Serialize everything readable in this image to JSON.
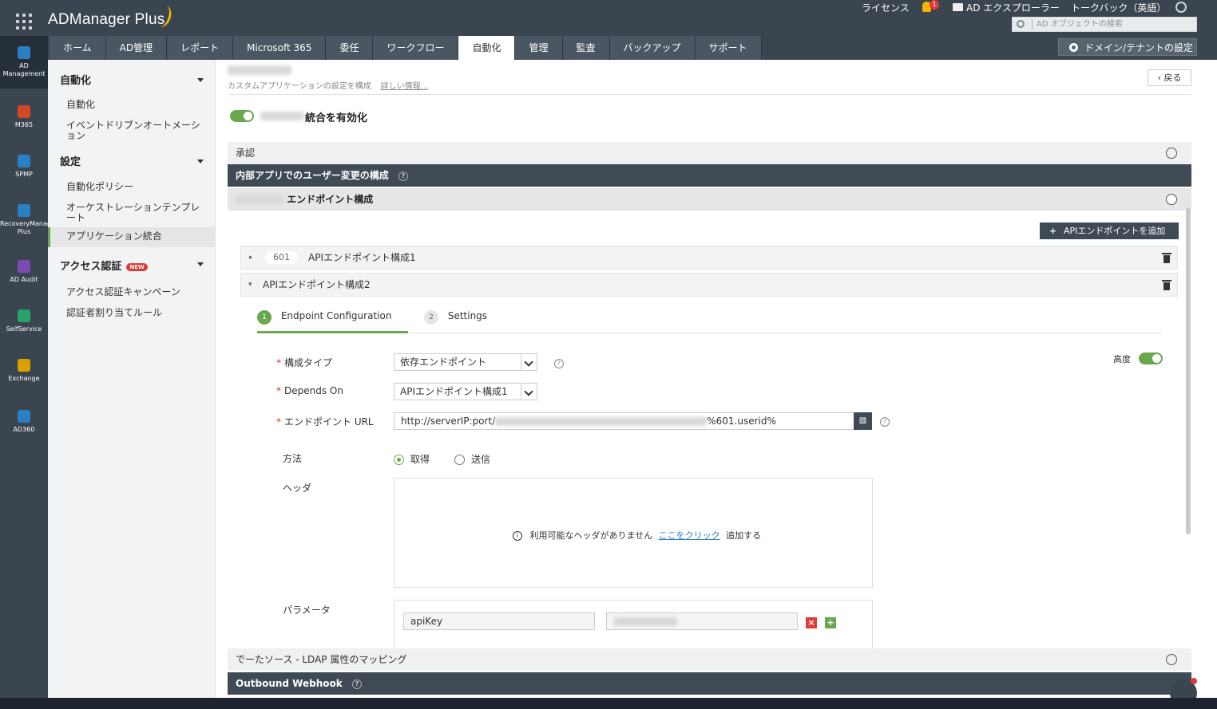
{
  "app": {
    "brand": "ADManager Plus",
    "top_links": {
      "license": "ライセンス",
      "notification_count": "1",
      "ad_explorer": "AD エクスプローラー",
      "talkback": "トークバック（英語）"
    },
    "search_placeholder": "AD オブジェクトの検索",
    "domain_button": "ドメイン/テナントの設定"
  },
  "tabs": [
    "ホーム",
    "AD管理",
    "レポート",
    "Microsoft 365",
    "委任",
    "ワークフロー",
    "自動化",
    "管理",
    "監査",
    "バックアップ",
    "サポート"
  ],
  "active_tab": "自動化",
  "rail": [
    {
      "label": "AD Management",
      "icon": "ad-management-icon",
      "color": "#2b7fc4"
    },
    {
      "label": "M365",
      "icon": "m365-icon",
      "color": "#d24726"
    },
    {
      "label": "SPMP",
      "icon": "spmp-icon",
      "color": "#2b7fc4"
    },
    {
      "label": "RecoveryManager Plus",
      "icon": "recovery-icon",
      "color": "#2b7fc4"
    },
    {
      "label": "AD Audit",
      "icon": "ad-audit-icon",
      "color": "#7a4bb5"
    },
    {
      "label": "SelfService",
      "icon": "selfservice-icon",
      "color": "#27a36a"
    },
    {
      "label": "Exchange",
      "icon": "exchange-icon",
      "color": "#d9a000"
    },
    {
      "label": "AD360",
      "icon": "ad360-icon",
      "color": "#2b7fc4"
    }
  ],
  "sidebar": {
    "automation_head": "自動化",
    "automation_items": [
      "自動化",
      "イベントドリブンオートメーション"
    ],
    "settings_head": "設定",
    "settings_items": [
      "自動化ポリシー",
      "オーケストレーションテンプレート",
      "アプリケーション統合"
    ],
    "access_head": "アクセス認証",
    "new_badge": "NEW",
    "access_items": [
      "アクセス認証キャンペーン",
      "認証者割り当てルール"
    ]
  },
  "main": {
    "subtitle": "カスタムアプリケーションの設定を構成",
    "more_info": "詳しい情報...",
    "back": "戻る",
    "enable_label": "統合を有効化",
    "sections": {
      "approval": "承認",
      "user_change": "内部アプリでのユーザー変更の構成",
      "endpoint_config": "エンドポイント構成",
      "datasource": "でーたソース - LDAP 属性のマッピング",
      "webhook": "Outbound Webhook"
    },
    "add_api_button": "APIエンドポイントを追加",
    "endpoint1": {
      "code": "601",
      "name": "APIエンドポイント構成1"
    },
    "endpoint2": {
      "name": "APIエンドポイント構成2"
    },
    "steps": [
      {
        "num": "1",
        "label": "Endpoint Configuration"
      },
      {
        "num": "2",
        "label": "Settings"
      }
    ],
    "advanced_label": "高度",
    "form": {
      "config_type_label": "構成タイプ",
      "config_type_value": "依存エンドポイント",
      "depends_on_label": "Depends On",
      "depends_on_value": "APIエンドポイント構成1",
      "endpoint_url_label": "エンドポイント URL",
      "endpoint_url_prefix": "http://serverIP:port/",
      "endpoint_url_suffix": "%601.userid%",
      "method_label": "方法",
      "method_get": "取得",
      "method_post": "送信",
      "header_label": "ヘッダ",
      "no_header_text": "利用可能なヘッダがありません",
      "click_here": "ここをクリック",
      "add_text": "追加する",
      "params_label": "パラメータ",
      "param_key": "apiKey"
    }
  }
}
